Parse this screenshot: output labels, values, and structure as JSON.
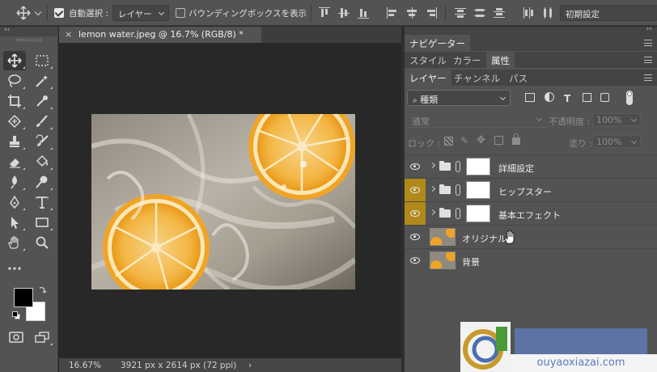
{
  "options_bar": {
    "auto_select_label": "自動選択 :",
    "auto_select_value": "レイヤー",
    "bounding_box_label": "バウンディングボックスを表示",
    "preset_value": "初期設定"
  },
  "document": {
    "tab_title": "lemon water.jpeg @ 16.7% (RGB/8) *",
    "close_glyph": "×"
  },
  "status_bar": {
    "zoom": "16.67%",
    "doc_info": "3921 px x 2614 px (72 ppi)",
    "arrow": "›"
  },
  "toolbar": {
    "collapse": "‹‹"
  },
  "panels": {
    "top_collapse": "››",
    "navigator_tab": "ナビゲーター",
    "group2_tabs": [
      "スタイル",
      "カラー",
      "属性"
    ],
    "group3_tabs": [
      "レイヤー",
      "チャンネル",
      "パス"
    ],
    "filter_kind": "種類",
    "blend_mode": "通常",
    "opacity_label": "不透明度 :",
    "opacity_value": "100%",
    "lock_label": "ロック :",
    "fill_label": "塗り :",
    "fill_value": "100%"
  },
  "layers": [
    {
      "name": "詳細設定",
      "type": "group",
      "eye_highlight": false
    },
    {
      "name": "ヒップスター",
      "type": "group",
      "eye_highlight": true
    },
    {
      "name": "基本エフェクト",
      "type": "group",
      "eye_highlight": true
    },
    {
      "name": "オリジナル",
      "type": "image",
      "eye_highlight": false
    },
    {
      "name": "背景",
      "type": "image",
      "eye_highlight": false
    }
  ],
  "watermark": {
    "text": "ouyaoxiazai.com"
  },
  "colors": {
    "highlight_eye": "#b0891a",
    "panel_bg": "#535353",
    "canvas_bg": "#282828",
    "lemon": "#f0a426"
  }
}
